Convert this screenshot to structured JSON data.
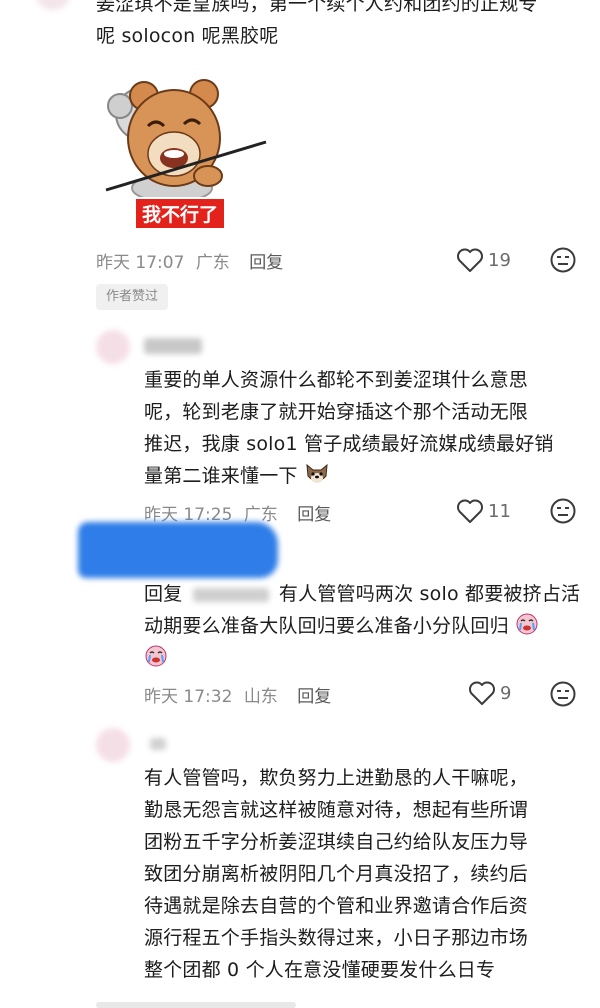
{
  "comment1": {
    "text_line1": "姜涩琪不是皇族吗，第一个续个人约和团约的正规专",
    "text_line2": "呢 solocon 呢黑胶呢",
    "sticker_caption": "我不行了",
    "time": "昨天 17:07",
    "location": "广东",
    "reply_label": "回复",
    "like_count": "19",
    "author_badge": "作者赞过"
  },
  "comment2": {
    "text": "重要的单人资源什么都轮不到姜涩琪什么意思呢，轮到老康了就开始穿插这个那个活动无限推迟，我康 solo1 管子成绩最好流媒成绩最好销量第二谁来懂一下",
    "lines": [
      "重要的单人资源什么都轮不到姜涩琪什么意思",
      "呢，轮到老康了就开始穿插这个那个活动无限",
      "推迟，我康 solo1 管子成绩最好流媒成绩最好销",
      "量第二谁来懂一下"
    ],
    "time": "昨天 17:25",
    "location": "广东",
    "reply_label": "回复",
    "like_count": "11"
  },
  "comment3": {
    "reply_prefix": "回复",
    "lines": [
      "有人管管吗两次 solo 都要被挤占活",
      "动期要么准备大队回归要么准备小分队回归"
    ],
    "time": "昨天 17:32",
    "location": "山东",
    "reply_label": "回复",
    "like_count": "9"
  },
  "comment4": {
    "lines": [
      "有人管管吗，欺负努力上进勤恳的人干嘛呢，",
      "勤恳无怨言就这样被随意对待，想起有些所谓",
      "团粉五千字分析姜涩琪续自己约给队友压力导",
      "致团分崩离析被阴阳几个月真没招了，续约后",
      "待遇就是除去自营的个管和业界邀请合作后资",
      "源行程五个手指头数得过来，小日子那边市场",
      "整个团都 0 个人在意没懂硬要发什么日专"
    ]
  },
  "icons": {
    "like": "heart-outline-icon",
    "dislike": "neutral-face-icon",
    "emoji_dog": "dog-emoji-icon",
    "emoji_cry": "crying-face-icon"
  },
  "colors": {
    "text": "#1d1d1d",
    "meta": "#8a8a8a",
    "sticker_red": "#e3221c",
    "redaction_blue": "#2e7de8"
  }
}
